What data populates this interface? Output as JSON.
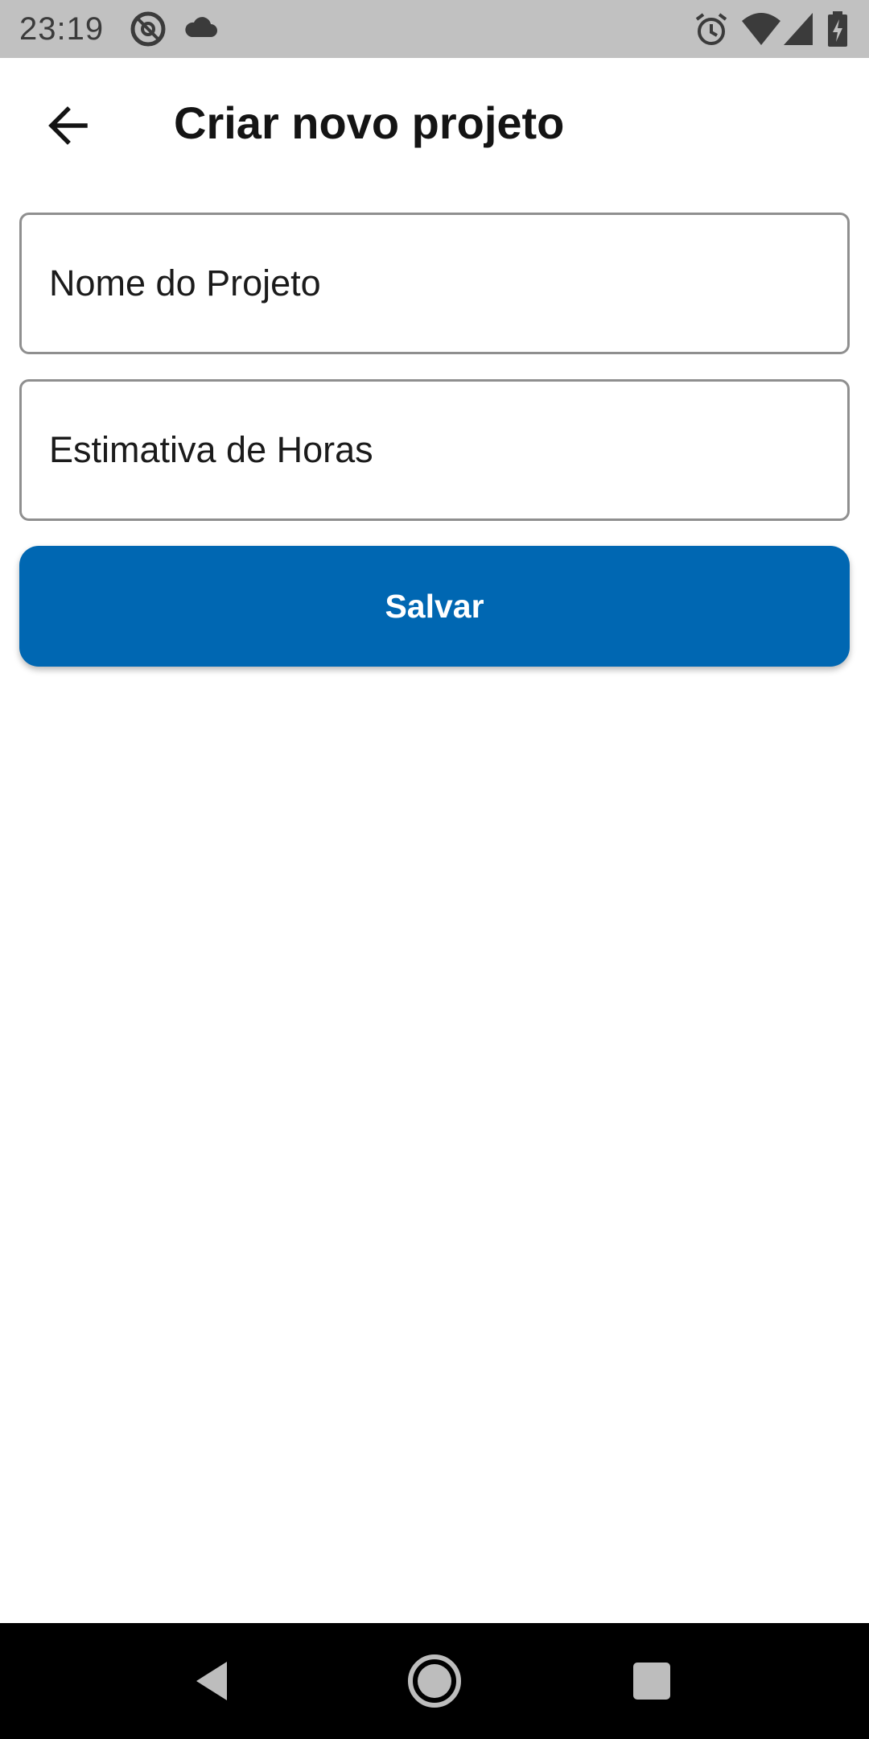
{
  "status_bar": {
    "time": "23:19",
    "icons": [
      "at-sign-icon",
      "cloud-icon",
      "alarm-icon",
      "wifi-icon",
      "cell-signal-icon",
      "battery-charging-icon"
    ],
    "background": "#c1c1c1"
  },
  "app_bar": {
    "title": "Criar novo projeto",
    "back_icon": "arrow-back-icon"
  },
  "form": {
    "project_name": {
      "placeholder": "Nome do Projeto",
      "value": ""
    },
    "hours_estimate": {
      "placeholder": "Estimativa de Horas",
      "value": ""
    },
    "save_label": "Salvar"
  },
  "nav_bar": {
    "buttons": [
      "nav-back-icon",
      "nav-home-icon",
      "nav-recents-icon"
    ]
  },
  "colors": {
    "accent": "#0067b2",
    "field_border": "#8f8f8f",
    "text": "#141414"
  }
}
